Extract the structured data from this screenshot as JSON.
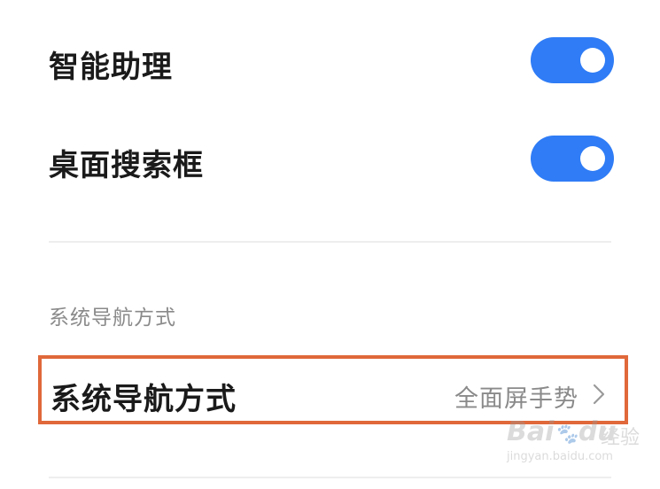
{
  "settings": {
    "assistant": {
      "label": "智能助理",
      "enabled": true
    },
    "desktop_search": {
      "label": "桌面搜索框",
      "enabled": true
    }
  },
  "navigation_section": {
    "header": "系统导航方式",
    "item": {
      "label": "系统导航方式",
      "value": "全面屏手势"
    }
  },
  "colors": {
    "toggle_on": "#2f7cf6",
    "highlight_border": "#e0683a"
  },
  "icons": {
    "chevron": "chevron-right-icon"
  },
  "watermark": {
    "brand": "Bai",
    "brand_suffix": "du",
    "brand_cn": "经验",
    "url": "jingyan.baidu.com"
  }
}
